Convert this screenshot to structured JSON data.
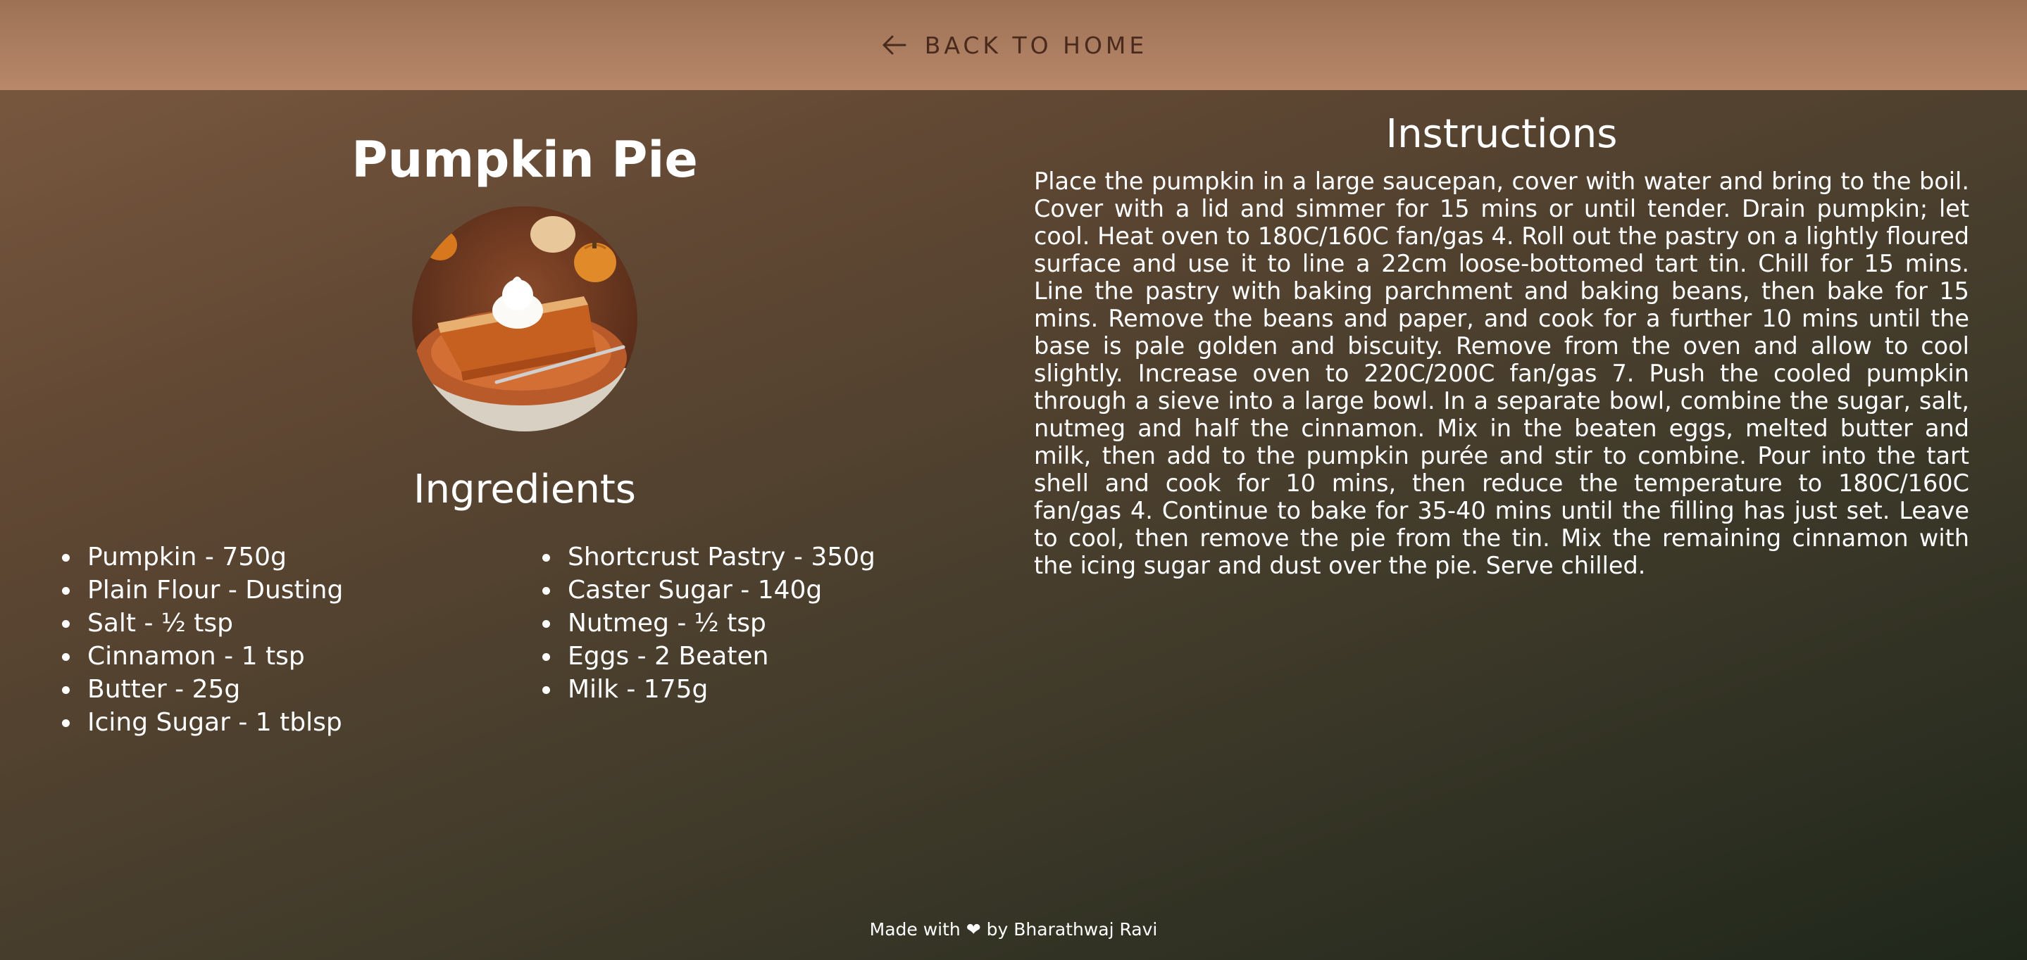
{
  "header": {
    "back_icon": "arrow-left-icon",
    "back_label": "BACK TO HOME"
  },
  "recipe": {
    "title": "Pumpkin Pie",
    "image_description_icon": "pumpkin-pie-photo"
  },
  "ingredients": {
    "heading": "Ingredients",
    "column1": [
      "Pumpkin - 750g",
      "Plain Flour - Dusting",
      "Salt - ½ tsp",
      "Cinnamon - 1 tsp",
      "Butter - 25g",
      "Icing Sugar - 1 tblsp"
    ],
    "column2": [
      "Shortcrust Pastry - 350g",
      "Caster Sugar - 140g",
      "Nutmeg - ½ tsp",
      "Eggs - 2 Beaten",
      "Milk - 175g"
    ]
  },
  "instructions": {
    "heading": "Instructions",
    "text": "Place the pumpkin in a large saucepan, cover with water and bring to the boil. Cover with a lid and simmer for 15 mins or until tender. Drain pumpkin; let cool. Heat oven to 180C/160C fan/gas 4. Roll out the pastry on a lightly floured surface and use it to line a 22cm loose-bottomed tart tin. Chill for 15 mins. Line the pastry with baking parchment and baking beans, then bake for 15 mins. Remove the beans and paper, and cook for a further 10 mins until the base is pale golden and biscuity. Remove from the oven and allow to cool slightly. Increase oven to 220C/200C fan/gas 7. Push the cooled pumpkin through a sieve into a large bowl. In a separate bowl, combine the sugar, salt, nutmeg and half the cinnamon. Mix in the beaten eggs, melted butter and milk, then add to the pumpkin purée and stir to combine. Pour into the tart shell and cook for 10 mins, then reduce the temperature to 180C/160C fan/gas 4. Continue to bake for 35-40 mins until the filling has just set. Leave to cool, then remove the pie from the tin. Mix the remaining cinnamon with the icing sugar and dust over the pie. Serve chilled."
  },
  "footer": {
    "prefix": "Made with",
    "heart": "❤",
    "suffix": "by Bharathwaj Ravi",
    "heart_icon": "heart-icon"
  },
  "colors": {
    "header_bg": "#b9876a",
    "header_text": "#4a2a1c",
    "body_text": "#ffffff"
  }
}
